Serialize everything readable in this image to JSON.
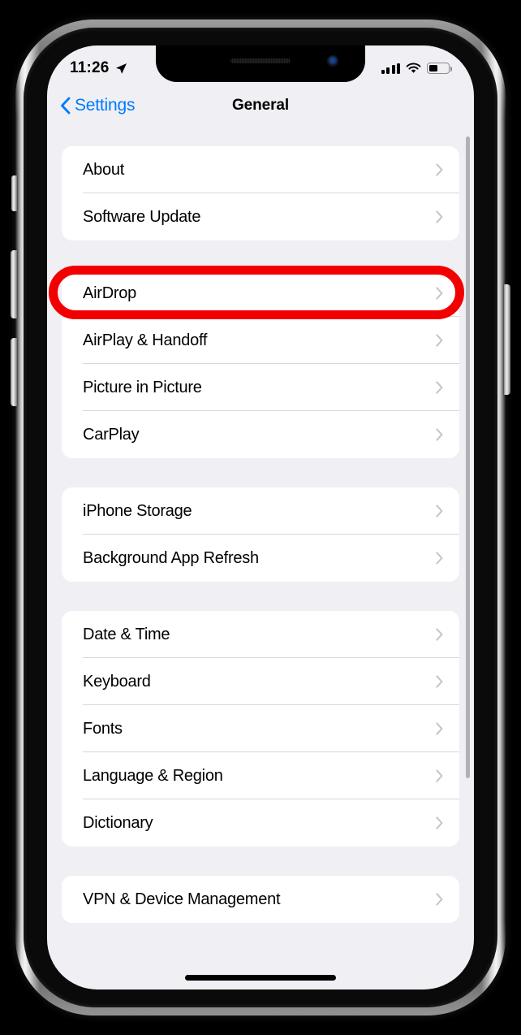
{
  "device": {
    "name": "iphone-x-silver",
    "frame_color": "#cfcfcf",
    "bezel_color": "#0a0a0a"
  },
  "status_bar": {
    "time": "11:26",
    "location_icon": "location-arrow-icon",
    "cellular_icon": "cellular-signal-icon",
    "cellular_bars": 4,
    "wifi_icon": "wifi-icon",
    "battery_icon": "battery-icon",
    "battery_level_percent": 45
  },
  "nav": {
    "back_icon": "chevron-left-icon",
    "back_label": "Settings",
    "title": "General",
    "accent_color": "#007aff"
  },
  "annotation": {
    "type": "red-rounded-rectangle-highlight",
    "target_row": "Software Update",
    "color": "#f20000",
    "stroke_width_px": 11
  },
  "scroll": {
    "indicator_visible": true,
    "indicator_color": "#b0b0b5"
  },
  "home_indicator": {
    "visible": true,
    "color": "#000000"
  },
  "groups": [
    {
      "id": "group-system",
      "rows": [
        {
          "label": "About",
          "chevron": "chevron-right-icon",
          "highlighted": false
        },
        {
          "label": "Software Update",
          "chevron": "chevron-right-icon",
          "highlighted": true
        }
      ]
    },
    {
      "id": "group-connectivity",
      "rows": [
        {
          "label": "AirDrop",
          "chevron": "chevron-right-icon",
          "highlighted": false
        },
        {
          "label": "AirPlay & Handoff",
          "chevron": "chevron-right-icon",
          "highlighted": false
        },
        {
          "label": "Picture in Picture",
          "chevron": "chevron-right-icon",
          "highlighted": false
        },
        {
          "label": "CarPlay",
          "chevron": "chevron-right-icon",
          "highlighted": false
        }
      ]
    },
    {
      "id": "group-storage",
      "rows": [
        {
          "label": "iPhone Storage",
          "chevron": "chevron-right-icon",
          "highlighted": false
        },
        {
          "label": "Background App Refresh",
          "chevron": "chevron-right-icon",
          "highlighted": false
        }
      ]
    },
    {
      "id": "group-localization",
      "rows": [
        {
          "label": "Date & Time",
          "chevron": "chevron-right-icon",
          "highlighted": false
        },
        {
          "label": "Keyboard",
          "chevron": "chevron-right-icon",
          "highlighted": false
        },
        {
          "label": "Fonts",
          "chevron": "chevron-right-icon",
          "highlighted": false
        },
        {
          "label": "Language & Region",
          "chevron": "chevron-right-icon",
          "highlighted": false
        },
        {
          "label": "Dictionary",
          "chevron": "chevron-right-icon",
          "highlighted": false
        }
      ]
    },
    {
      "id": "group-management",
      "rows": [
        {
          "label": "VPN & Device Management",
          "chevron": "chevron-right-icon",
          "highlighted": false
        }
      ]
    }
  ],
  "side_buttons": [
    {
      "name": "mute-switch"
    },
    {
      "name": "volume-up-button"
    },
    {
      "name": "volume-down-button"
    },
    {
      "name": "power-button"
    }
  ]
}
